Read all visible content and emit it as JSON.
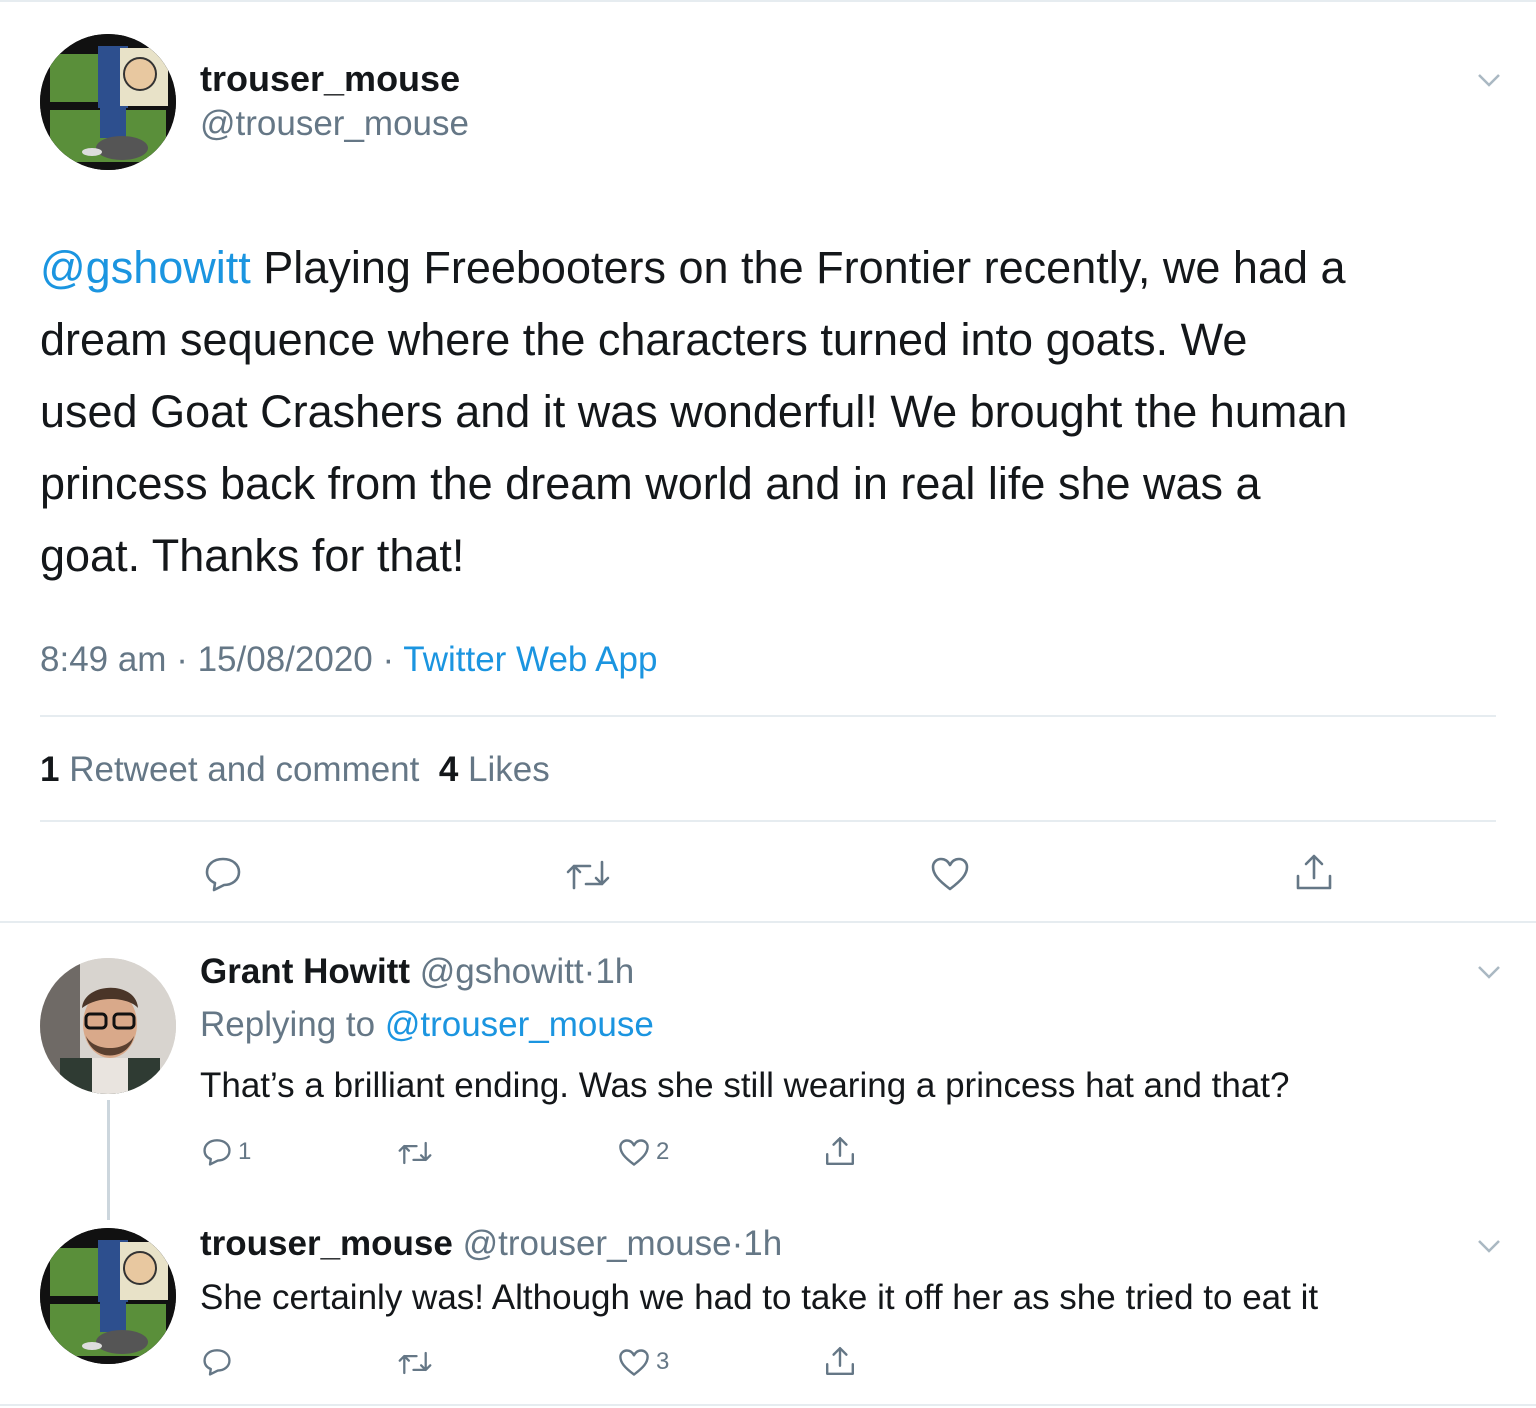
{
  "main_tweet": {
    "display_name": "trouser_mouse",
    "handle": "@trouser_mouse",
    "mention": "@gshowitt",
    "body_lines": [
      "Playing Freebooters on the Frontier recently, we had a",
      "dream sequence where the characters turned into goats. We",
      "used Goat Crashers and it was wonderful! We brought the human",
      "princess back from the dream world and in real life she was a",
      "goat. Thanks for that!"
    ],
    "time": "8:49 am",
    "date": "15/08/2020",
    "separator": "·",
    "source": "Twitter Web App",
    "retweet_count": "1",
    "retweet_label": "Retweet and comment",
    "like_count": "4",
    "like_label": "Likes"
  },
  "reply1": {
    "display_name": "Grant Howitt",
    "handle": "@gshowitt",
    "separator": "·",
    "time": "1h",
    "replying_label": "Replying to",
    "replying_to": "@trouser_mouse",
    "text": "That’s a brilliant ending. Was she still wearing a princess hat and that?",
    "reply_count": "1",
    "like_count": "2"
  },
  "reply2": {
    "display_name": "trouser_mouse",
    "handle": "@trouser_mouse",
    "separator": "·",
    "time": "1h",
    "text": "She certainly was! Although we had to take it off her as she tried to eat it",
    "like_count": "3"
  },
  "colors": {
    "link": "#1b95e0",
    "secondary": "#657786",
    "divider": "#e6ecf0",
    "text": "#14171a"
  }
}
